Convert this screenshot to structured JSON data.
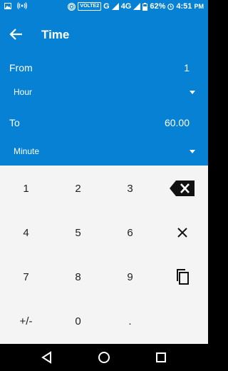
{
  "status_bar": {
    "volte": "VOLTE2",
    "network_g": "G",
    "network_4g": "4G",
    "network_4g_sup": "4G",
    "battery": "62%",
    "time": "4:51",
    "time_suffix": "PM"
  },
  "app": {
    "title": "Time"
  },
  "from": {
    "label": "From",
    "value": "1",
    "unit": "Hour"
  },
  "to": {
    "label": "To",
    "value": "60.00",
    "unit": "Minute"
  },
  "keypad": {
    "row1": [
      "1",
      "2",
      "3"
    ],
    "row2": [
      "4",
      "5",
      "6"
    ],
    "row3": [
      "7",
      "8",
      "9"
    ],
    "row4": [
      "+/-",
      "0",
      "."
    ]
  },
  "icons": {
    "back": "arrow-left-icon",
    "backspace": "backspace-icon",
    "clear": "close-icon",
    "copy": "copy-icon",
    "dropdown": "caret-down-icon"
  },
  "colors": {
    "primary": "#0681d4",
    "keypad_bg": "#f4f4f4",
    "navbar": "#000000"
  }
}
